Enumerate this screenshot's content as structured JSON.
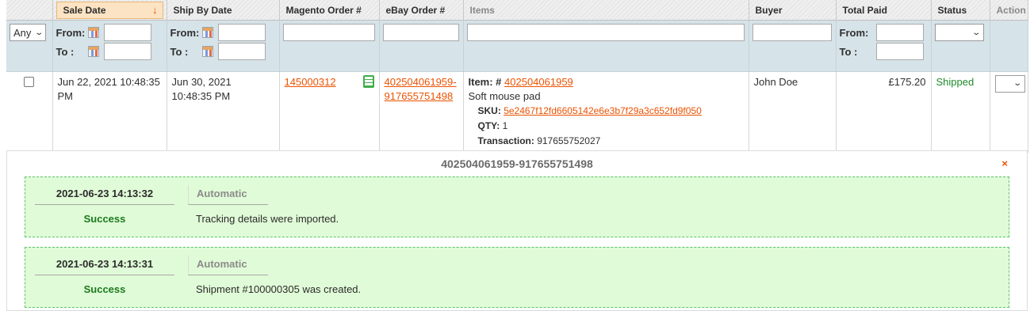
{
  "headers": {
    "sale_date": "Sale Date",
    "ship_by_date": "Ship By Date",
    "magento_order": "Magento Order #",
    "ebay_order": "eBay Order #",
    "items": "Items",
    "buyer": "Buyer",
    "total_paid": "Total Paid",
    "status": "Status",
    "action": "Action"
  },
  "filters": {
    "checkbox_select": "Any",
    "from_label": "From:",
    "to_label": "To :"
  },
  "row": {
    "sale_date": "Jun 22, 2021 10:48:35 PM",
    "ship_by_date": "Jun 30, 2021 10:48:35 PM",
    "magento_order": "145000312",
    "ebay_order": "402504061959-917655751498",
    "item_label": "Item: #",
    "item_number": "402504061959",
    "item_title": "Soft mouse pad",
    "sku_label": "SKU:",
    "sku": "5e2467f12fd6605142e6e3b7f29a3c652fd9f050",
    "qty_label": "QTY:",
    "qty": "1",
    "transaction_label": "Transaction:",
    "transaction": "917655752027",
    "buyer": "John Doe",
    "total_paid": "£175.20",
    "status": "Shipped",
    "status_color": "#1f8a2b"
  },
  "log": {
    "title": "402504061959-917655751498",
    "close": "×",
    "entries": [
      {
        "date": "2021-06-23 14:13:32",
        "type": "Automatic",
        "status": "Success",
        "message": "Tracking details were imported."
      },
      {
        "date": "2021-06-23 14:13:31",
        "type": "Automatic",
        "status": "Success",
        "message": "Shipment #100000305 was created."
      }
    ]
  },
  "colors": {
    "accent": "#eb5202",
    "success_bg": "#e0fbd7",
    "filter_bg": "#d6e3e9"
  }
}
